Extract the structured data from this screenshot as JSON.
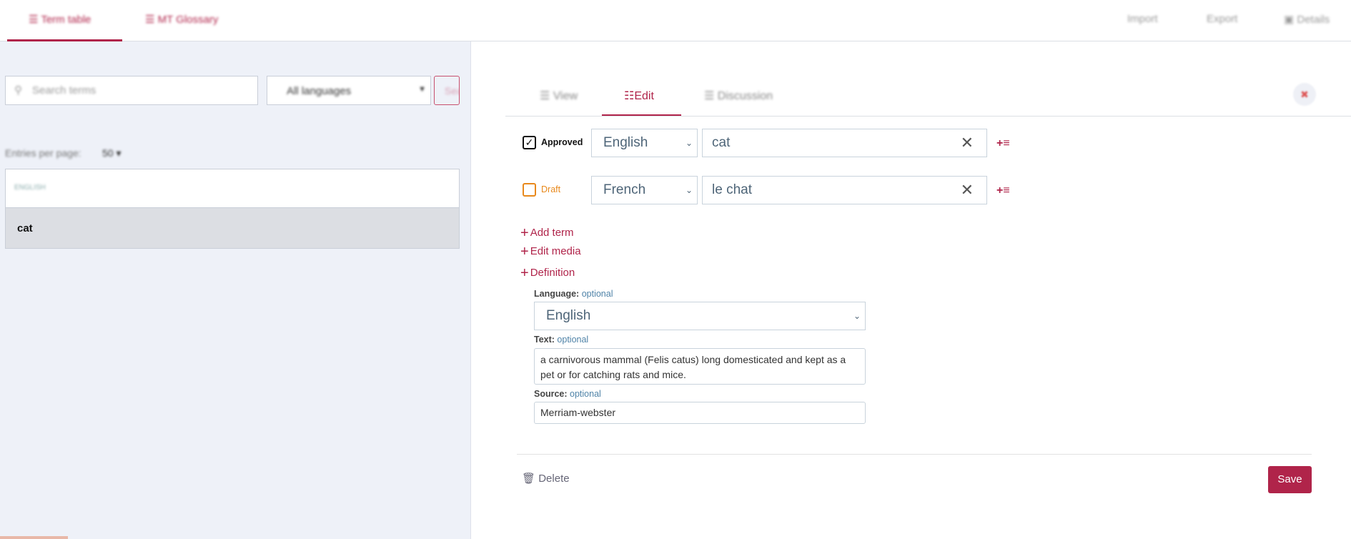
{
  "header": {
    "tabs": [
      {
        "label": "Term table",
        "icon": "list-icon"
      },
      {
        "label": "MT Glossary",
        "icon": "list-icon"
      }
    ],
    "links": [
      "Import",
      "Export",
      "Details"
    ]
  },
  "left": {
    "search_placeholder": "Search terms",
    "language_select": "All languages",
    "search_button": "Search",
    "entries_label": "Entries per page:",
    "entries_value": "50",
    "table_header": "ENGLISH",
    "rows": [
      "cat"
    ]
  },
  "editor": {
    "tabs": [
      "View",
      "Edit",
      "Discussion"
    ],
    "active_tab": "Edit",
    "terms": [
      {
        "status": "Approved",
        "checked": true,
        "language": "English",
        "value": "cat"
      },
      {
        "status": "Draft",
        "checked": false,
        "language": "French",
        "value": "le chat"
      }
    ],
    "actions": [
      "Add term",
      "Edit media",
      "Definition"
    ],
    "definition": {
      "language_label": "Language:",
      "text_label": "Text:",
      "source_label": "Source:",
      "optional": "optional",
      "language": "English",
      "text": "a carnivorous mammal (Felis catus) long domesticated and kept as a pet or for catching rats and mice.",
      "source": "Merriam-webster"
    },
    "delete_label": "Delete",
    "save_label": "Save"
  },
  "colors": {
    "accent": "#b0244a",
    "draft": "#e8891c",
    "panel_bg": "#eef1f8"
  }
}
